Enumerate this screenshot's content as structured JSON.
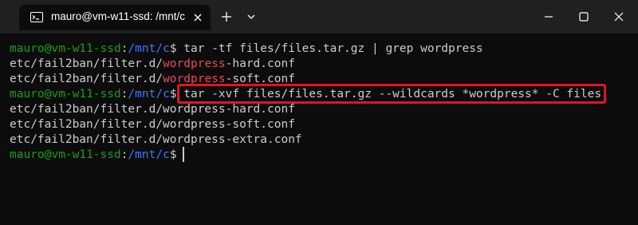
{
  "window": {
    "tab_title": "mauro@vm-w11-ssd: /mnt/c",
    "icons": {
      "tab": "terminal-icon",
      "close_tab": "close-icon",
      "new_tab": "plus-icon",
      "dropdown": "chevron-down-icon",
      "minimize": "minimize-icon",
      "maximize": "maximize-icon",
      "close": "close-icon"
    }
  },
  "colors": {
    "background": "#0c0c0c",
    "titlebar": "#202020",
    "prompt_user": "#13a10e",
    "prompt_path": "#3b78ff",
    "text": "#cccccc",
    "match": "#e74856",
    "highlight_border": "#e81123"
  },
  "terminal": {
    "prompt_user": "mauro@vm-w11-ssd",
    "prompt_sep": ":",
    "prompt_path": "/mnt/c",
    "prompt_dollar": "$",
    "command1": " tar -tf files/files.tar.gz | grep wordpress",
    "grep_results": [
      {
        "prefix": "etc/fail2ban/filter.d/",
        "match": "wordpress",
        "suffix": "-hard.conf"
      },
      {
        "prefix": "etc/fail2ban/filter.d/",
        "match": "wordpress",
        "suffix": "-soft.conf"
      }
    ],
    "command2": "tar -xvf files/files.tar.gz --wildcards *wordpress* -C files",
    "extracted": [
      "etc/fail2ban/filter.d/wordpress-hard.conf",
      "etc/fail2ban/filter.d/wordpress-soft.conf",
      "etc/fail2ban/filter.d/wordpress-extra.conf"
    ]
  }
}
